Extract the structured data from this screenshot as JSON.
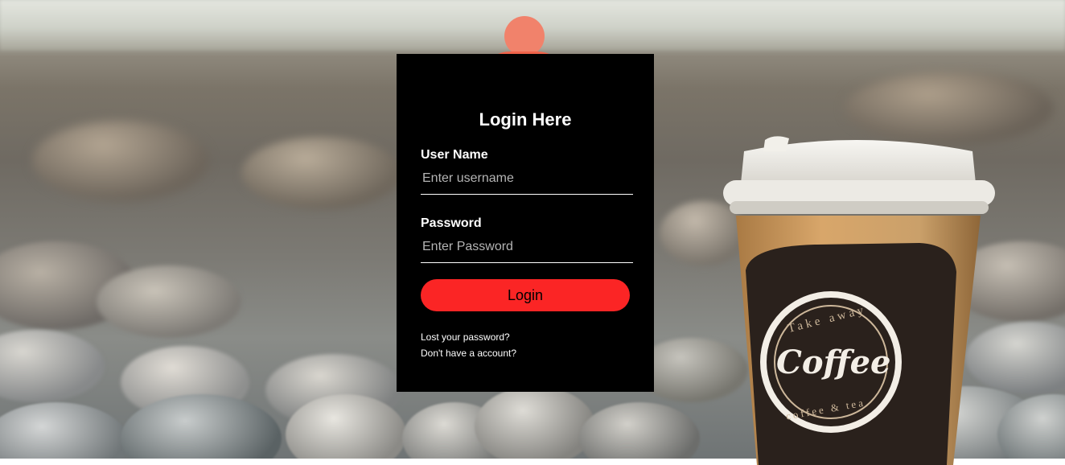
{
  "login": {
    "title": "Login Here",
    "username_label": "User Name",
    "username_placeholder": "Enter username",
    "username_value": "",
    "password_label": "Password",
    "password_placeholder": "Enter Password",
    "password_value": "",
    "submit_label": "Login",
    "lost_password_link": "Lost your password?",
    "signup_link": "Don't have a account?"
  },
  "background": {
    "cup_logo_arc_text": "Take away",
    "cup_logo_word": "Coffee",
    "cup_logo_bottom_text": "coffee & tea"
  },
  "colors": {
    "panel": "#000000",
    "accent_button": "#fb2525",
    "avatar_head": "#f1826b",
    "avatar_body": "#f0634a"
  }
}
